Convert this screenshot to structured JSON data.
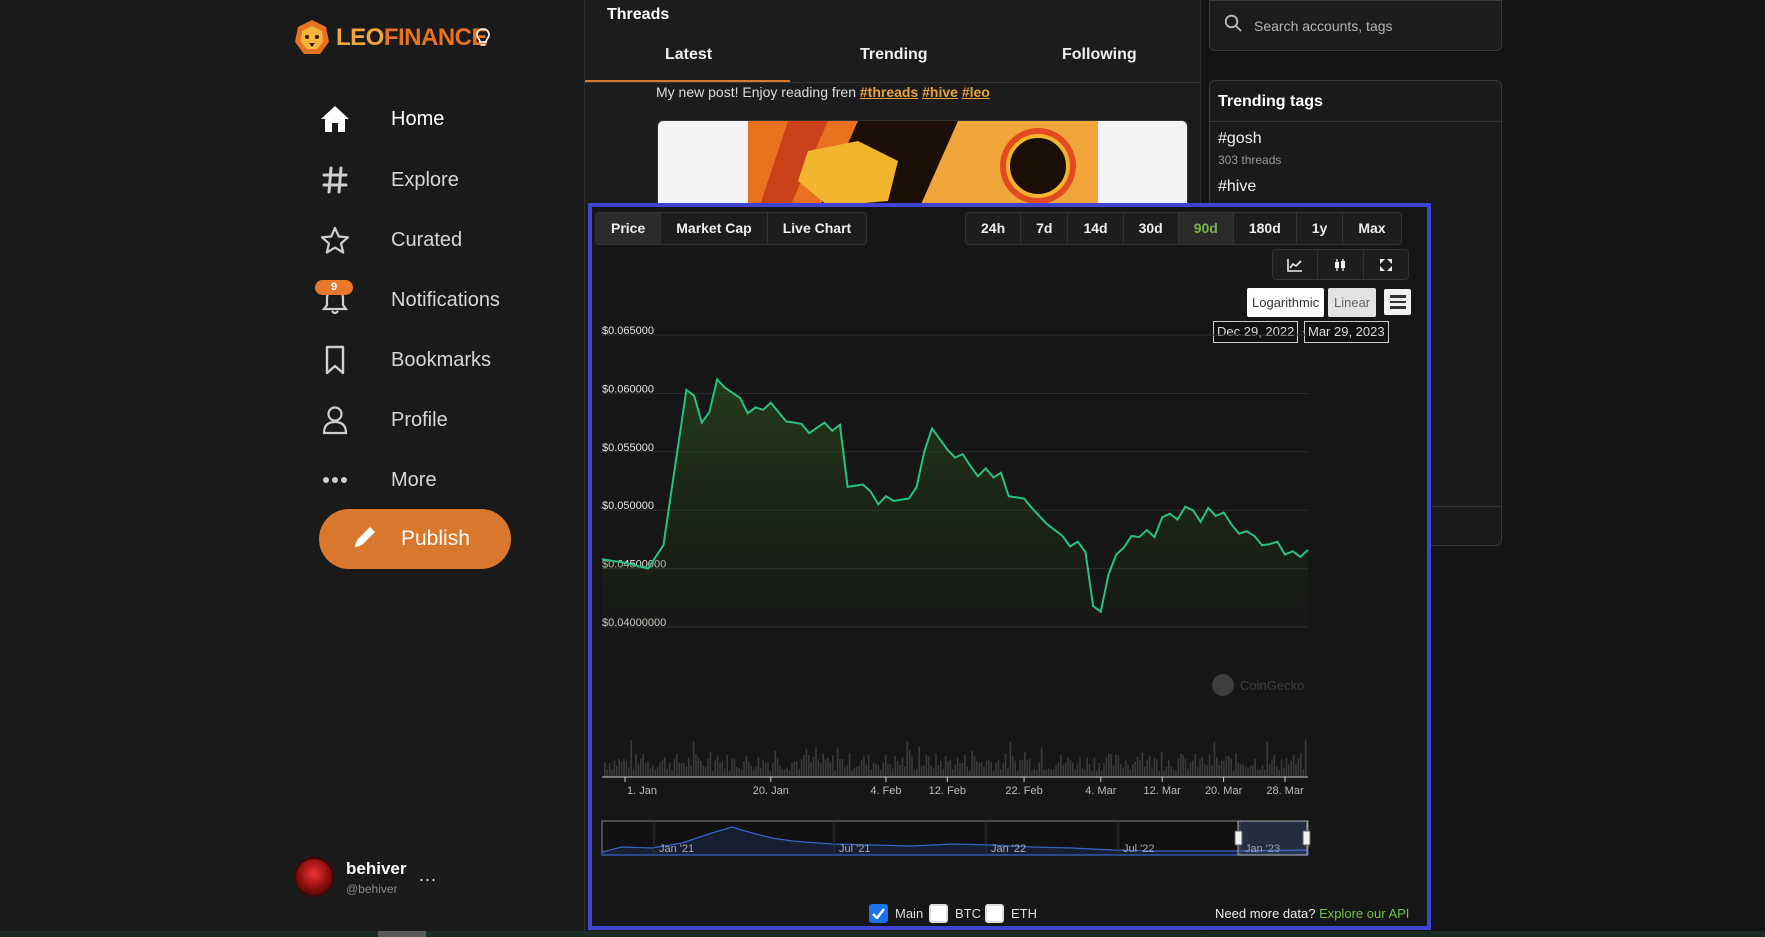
{
  "brand": {
    "part1": "LEO",
    "part2": "FINANCE"
  },
  "nav": {
    "home": "Home",
    "explore": "Explore",
    "curated": "Curated",
    "notifications": "Notifications",
    "notifications_count": "9",
    "bookmarks": "Bookmarks",
    "profile": "Profile",
    "more": "More",
    "publish": "Publish"
  },
  "user": {
    "name": "behiver",
    "handle": "@behiver",
    "menu": "..."
  },
  "feed": {
    "title": "Threads",
    "tabs": [
      "Latest",
      "Trending",
      "Following"
    ],
    "active_tab": "Latest",
    "post_text": "My new post! Enjoy reading fren ",
    "post_tags": [
      "#threads",
      "#hive",
      "#leo"
    ]
  },
  "search": {
    "placeholder": "Search accounts, tags"
  },
  "trending": {
    "title": "Trending tags",
    "tags": [
      {
        "tag": "#gosh",
        "count": "303 threads"
      },
      {
        "tag": "#hive",
        "count": ""
      }
    ]
  },
  "widget": {
    "metric_tabs": [
      "Price",
      "Market Cap",
      "Live Chart"
    ],
    "selected_metric": "Price",
    "range_tabs": [
      "24h",
      "7d",
      "14d",
      "30d",
      "90d",
      "180d",
      "1y",
      "Max"
    ],
    "selected_range": "90d",
    "scale_log": "Logarithmic",
    "scale_linear": "Linear",
    "date_from": "Dec 29, 2022",
    "date_arrow": "→",
    "date_to": "Mar 29, 2023",
    "watermark": "CoinGecko",
    "compare": [
      {
        "label": "Main",
        "checked": true
      },
      {
        "label": "BTC",
        "checked": false
      },
      {
        "label": "ETH",
        "checked": false
      }
    ],
    "api_text": "Need more data? ",
    "api_link": "Explore our API",
    "navigator_labels": [
      "Jan '21",
      "Jul '21",
      "Jan '22",
      "Jul '22",
      "Jan '23"
    ],
    "accent": "#26c281",
    "frame_color": "#4143d2"
  },
  "chart_data": {
    "type": "area",
    "title": "",
    "xlabel": "",
    "ylabel": "",
    "y_tick_labels": [
      "$0.065000",
      "$0.060000",
      "$0.055000",
      "$0.050000",
      "$0.04500000",
      "$0.04000000"
    ],
    "y_ticks": [
      0.065,
      0.06,
      0.055,
      0.05,
      0.045,
      0.04
    ],
    "ylim": [
      0.04,
      0.065
    ],
    "x_tick_labels": [
      "1. Jan",
      "20. Jan",
      "4. Feb",
      "12. Feb",
      "22. Feb",
      "4. Mar",
      "12. Mar",
      "20. Mar",
      "28. Mar"
    ],
    "x_tick_days": [
      0,
      19,
      34,
      42,
      52,
      62,
      70,
      78,
      86
    ],
    "x_days": [
      -3,
      0,
      3,
      5,
      8,
      9,
      10,
      11,
      12,
      13,
      15,
      16,
      17,
      18,
      19,
      21,
      23,
      24,
      26,
      27,
      28,
      29,
      31,
      32,
      33,
      34,
      35,
      37,
      38,
      39,
      40,
      42,
      43,
      44,
      45,
      46,
      47,
      48,
      49,
      50,
      52,
      53,
      54,
      55,
      56,
      57,
      58,
      59,
      60,
      61,
      62,
      63,
      64,
      65,
      66,
      67,
      68,
      69,
      70,
      71,
      72,
      73,
      74,
      75,
      76,
      77,
      78,
      79,
      80,
      81,
      82,
      83,
      84,
      85,
      86,
      87,
      88,
      89
    ],
    "price": [
      0.0458,
      0.0455,
      0.045,
      0.047,
      0.0603,
      0.0598,
      0.0575,
      0.0584,
      0.0612,
      0.0605,
      0.0596,
      0.0583,
      0.0588,
      0.0586,
      0.0592,
      0.0576,
      0.0574,
      0.0566,
      0.0575,
      0.0568,
      0.0573,
      0.052,
      0.0522,
      0.0516,
      0.0505,
      0.0512,
      0.0508,
      0.051,
      0.052,
      0.055,
      0.057,
      0.0552,
      0.0545,
      0.0548,
      0.0538,
      0.0529,
      0.0536,
      0.0528,
      0.0532,
      0.0512,
      0.051,
      0.0502,
      0.0495,
      0.0488,
      0.0483,
      0.0478,
      0.0469,
      0.0473,
      0.0464,
      0.0418,
      0.0413,
      0.0445,
      0.0462,
      0.0468,
      0.0478,
      0.0477,
      0.0483,
      0.0477,
      0.0494,
      0.0497,
      0.0492,
      0.0503,
      0.05,
      0.049,
      0.0502,
      0.0495,
      0.0498,
      0.0488,
      0.048,
      0.0482,
      0.0478,
      0.047,
      0.0471,
      0.0473,
      0.0462,
      0.0465,
      0.046,
      0.0466
    ],
    "volume_bars": true,
    "grid": true,
    "legend": "bottom"
  }
}
